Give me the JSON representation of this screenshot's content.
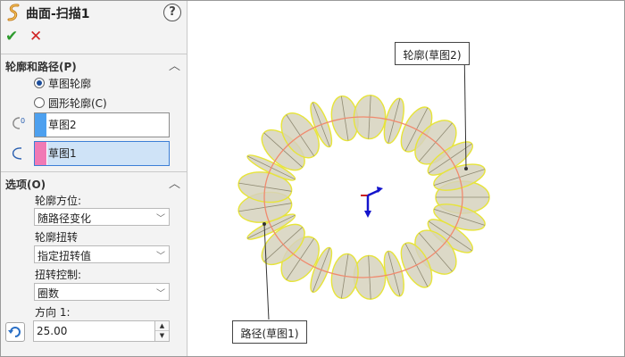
{
  "panel": {
    "title": "曲面-扫描1",
    "help_label": "?",
    "ok_label": "✔",
    "cancel_label": "✕",
    "profile_group": {
      "title": "轮廓和路径(P)",
      "radio_sketch_label": "草图轮廓",
      "radio_circle_label": "圆形轮廓(C)",
      "profile_selection": "草图2",
      "path_selection": "草图1",
      "profile_color": "#4da0ef",
      "path_color": "#f07ab5"
    },
    "options_group": {
      "title": "选项(O)",
      "orientation_label": "轮廓方位:",
      "orientation_value": "随路径变化",
      "twist_label": "轮廓扭转",
      "twist_value": "指定扭转值",
      "twist_control_label": "扭转控制:",
      "twist_control_value": "圈数",
      "direction_label": "方向 1:",
      "direction_value": "25.00"
    }
  },
  "viewport": {
    "profile_callout": "轮廓(草图2)",
    "path_callout": "路径(草图1)",
    "surface_color": "#d6d2bd",
    "edge_color": "#e7e43a",
    "path_color": "#f08a6e",
    "triad_colors": {
      "x": "#cc2020",
      "y": "#1414cc",
      "z": "#1414cc"
    }
  }
}
